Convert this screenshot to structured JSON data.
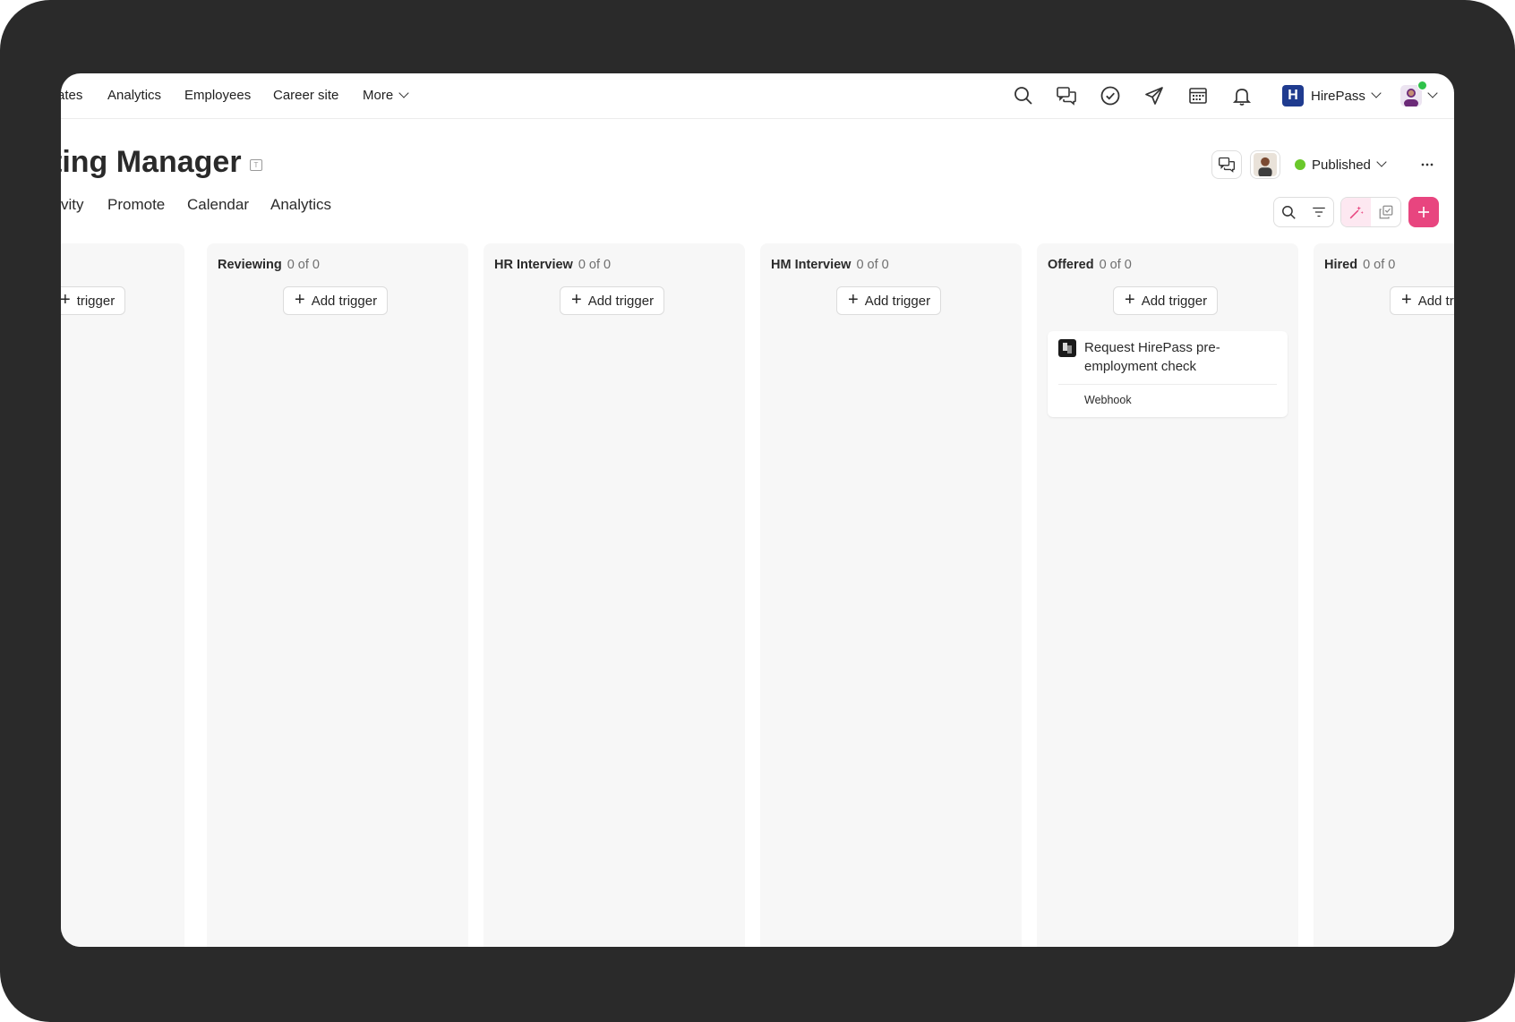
{
  "nav": {
    "items": [
      "ates",
      "Analytics",
      "Employees",
      "Career site"
    ],
    "more_label": "More"
  },
  "icons": [
    "search-icon",
    "chat-icon",
    "check-circle-icon",
    "send-icon",
    "calendar-icon",
    "bell-icon"
  ],
  "org": {
    "badge": "H",
    "name": "HirePass",
    "color": "#1f3b8f"
  },
  "job": {
    "title": "ting Manager",
    "status": "Published",
    "status_color": "#6ac82b"
  },
  "tabs": [
    "vity",
    "Promote",
    "Calendar",
    "Analytics"
  ],
  "accent_color": "#e8457f",
  "columns": [
    {
      "name": "",
      "count": "",
      "trigger_label": "trigger"
    },
    {
      "name": "Reviewing",
      "count": "0 of 0",
      "trigger_label": "Add trigger"
    },
    {
      "name": "HR Interview",
      "count": "0 of 0",
      "trigger_label": "Add trigger"
    },
    {
      "name": "HM Interview",
      "count": "0 of 0",
      "trigger_label": "Add trigger"
    },
    {
      "name": "Offered",
      "count": "0 of 0",
      "trigger_label": "Add trigger",
      "card": {
        "title": "Request HirePass pre-employment check",
        "type": "Webhook"
      }
    },
    {
      "name": "Hired",
      "count": "0 of 0",
      "trigger_label": "Add tr"
    }
  ]
}
